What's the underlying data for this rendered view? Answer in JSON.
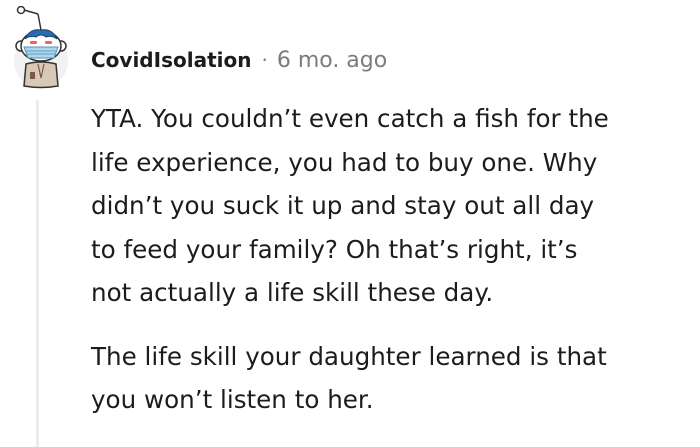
{
  "comment": {
    "author": "CovidIsolation",
    "separator": "·",
    "timestamp": "6 mo. ago",
    "avatar_icon": "snoo-avatar-with-mask-icon",
    "paragraphs": [
      "YTA. You couldn’t even catch a fish for the\nlife experience, you had to buy one. Why\ndidn’t you suck it up and stay out all day\nto feed your family? Oh that’s right, it’s\nnot actually a life skill these day.",
      "The life skill your daughter learned is that\nyou won’t listen to her."
    ]
  },
  "colors": {
    "text": "#1c1c1c",
    "meta": "#7c7c7c",
    "thread_line": "#ececec",
    "mask": "#a8d8f0",
    "hair": "#2b6cb0"
  }
}
